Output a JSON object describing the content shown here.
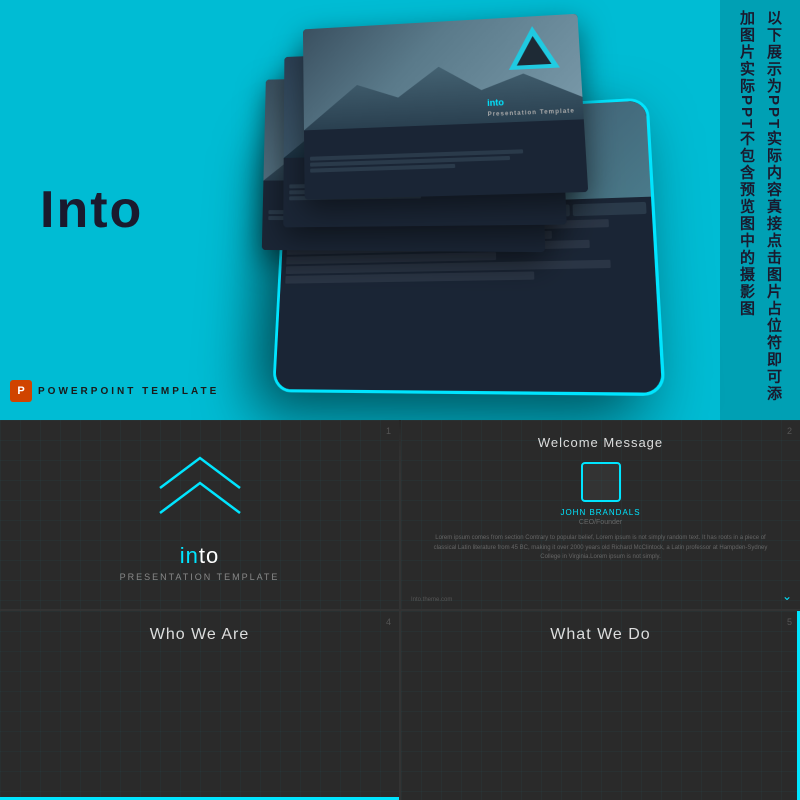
{
  "top": {
    "into_title": "Into",
    "teal_bg": "#00bcd4",
    "ppt_label": "POWERPOINT TEMPLATE",
    "ppt_icon": "P"
  },
  "chinese": {
    "lines": [
      "以下展示为PPT实际内容",
      "真接点击图片占位符即可添加图片",
      "实际PPT不包含预览图中的摄影图"
    ]
  },
  "slides": {
    "slide2": {
      "logo": "into",
      "logo_highlight": "in",
      "subtitle": "Presentation Template",
      "num": "1"
    },
    "slide3": {
      "title": "Welcome Message",
      "person_name": "JOHN BRANDALS",
      "person_role": "CEO/Founder",
      "body_text": "Lorem ipsum comes from section Contrary to popular belief, Lorem ipsum is not simply random text. It has roots in a piece of classical Latin literature from 45 BC, making it over 2000 years old Richard McClintock, a Latin professor at Hampden-Sydney College in Virginia.Lorem ipsum is not simply.",
      "footer": "Into.theme.com",
      "num": "2"
    },
    "slide4": {
      "title": "Who We Are",
      "num": "4"
    },
    "slide5": {
      "title": "What We Do",
      "num": "5"
    }
  },
  "tablet": {
    "logo": "into",
    "subtitle": "Presentation Template"
  }
}
